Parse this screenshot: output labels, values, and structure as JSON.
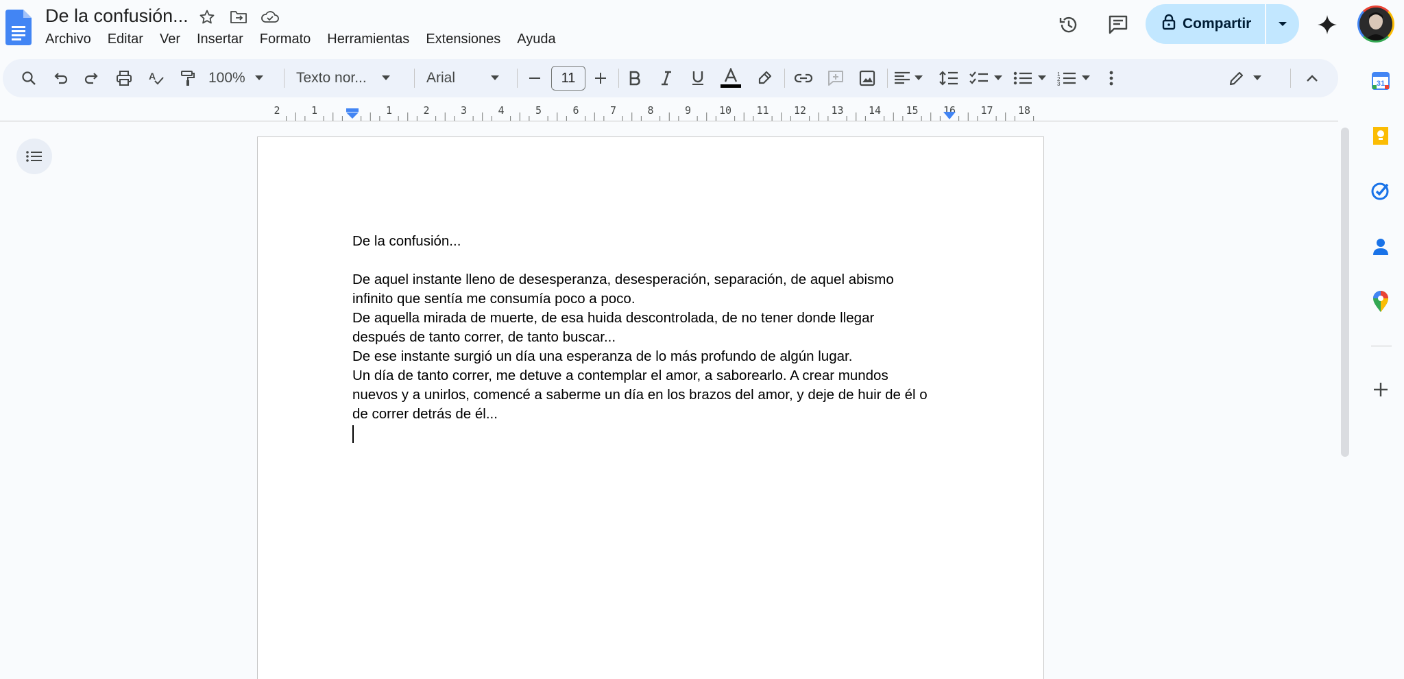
{
  "document": {
    "title": "De la confusión...",
    "body_paragraphs": [
      "De la confusión...",
      "",
      "De aquel instante lleno de desesperanza, desesperación, separación, de aquel abismo",
      "infinito que sentía me consumía poco a poco.",
      "De aquella mirada de muerte, de esa huida descontrolada, de no tener donde llegar",
      "después de tanto correr, de tanto buscar...",
      "De ese instante surgió un día una esperanza de lo más profundo de algún lugar.",
      "Un día de tanto correr, me detuve a contemplar el amor, a saborearlo. A crear mundos",
      "nuevos y a unirlos, comencé a saberme un día en los brazos del amor, y deje de huir de él o",
      "de correr detrás de él..."
    ]
  },
  "menu": [
    "Archivo",
    "Editar",
    "Ver",
    "Insertar",
    "Formato",
    "Herramientas",
    "Extensiones",
    "Ayuda"
  ],
  "share": {
    "label": "Compartir"
  },
  "toolbar": {
    "zoom": "100%",
    "style": "Texto nor...",
    "font": "Arial",
    "font_size": "11"
  },
  "ruler": {
    "numbers_left": [
      "2",
      "1"
    ],
    "numbers_right": [
      "1",
      "2",
      "3",
      "4",
      "5",
      "6",
      "7",
      "8",
      "9",
      "10",
      "11",
      "12",
      "13",
      "14",
      "15",
      "16",
      "17",
      "18"
    ]
  },
  "colors": {
    "share_bg": "#c2e7ff",
    "toolbar_bg": "#edf2fa",
    "accent_blue": "#1a73e8",
    "page_bg": "#ffffff",
    "app_bg": "#f9fbfd"
  }
}
